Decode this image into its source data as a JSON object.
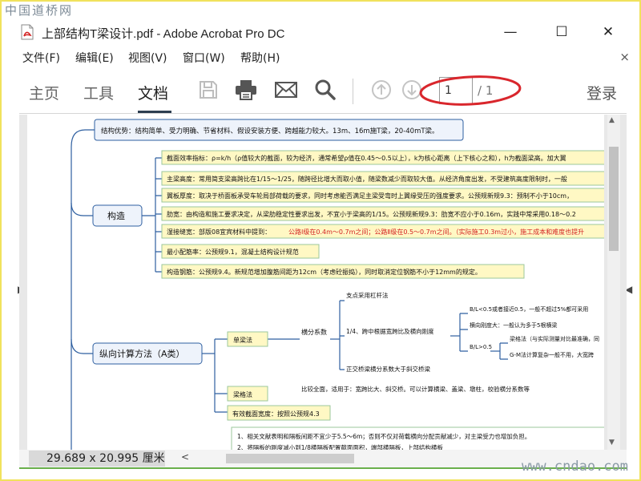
{
  "watermark": {
    "top": "中国道桥网",
    "bottom": "www.cndao.com"
  },
  "window": {
    "title": "上部结构T梁设计.pdf - Adobe Acrobat Pro DC",
    "minimize": "—",
    "maximize": "☐",
    "close": "✕"
  },
  "menu": {
    "items": [
      "文件(F)",
      "编辑(E)",
      "视图(V)",
      "窗口(W)",
      "帮助(H)"
    ],
    "close": "×"
  },
  "toolbar": {
    "tabs": [
      "主页",
      "工具",
      "文档"
    ],
    "active_tab": "文档",
    "page_current": "1",
    "page_total": "/ 1",
    "login": "登录"
  },
  "status": {
    "page_size": "29.689 x 20.995 厘米"
  },
  "colors": {
    "accent": "#2d3e50",
    "highlight_ellipse": "#d9262c",
    "node_border": "#9bc79b",
    "node_fill_yellow": "#fff8c4",
    "node_fill_blue": "#eef3fb",
    "line": "#2e5fa0"
  },
  "mindmap": {
    "top": "结构优势：结构简单、受力明确、节省材料、假设安装方便、跨越能力较大。13m、16m施T梁，20-40mT梁。",
    "construct": "构造",
    "construct_items": [
      "截面效率指标：ρ=k/h（ρ值较大的截面，较为经济，通常希望ρ值在0.45～0.5以上），k为核心距离（上下核心之和），h为截面梁高。加大翼",
      "主梁高度：常用简支梁高跨比在1/15～1/25，随跨径比增大而取小值，随梁数减少而取较大值。从经济角度出发，不受建筑高度限制时，一般",
      "翼板厚度：取决于桥面板承受车轮局部荷载的要求，同时考虑能否满足主梁受弯时上翼缘受压的强度要求。公预规新规9.3：预制不小于10cm，",
      "肋宽：由构造和施工要求决定，从梁肋稳定性要求出发，不宜小于梁高的1/15。公预规新规9.3：肋宽不应小于0.16m，实践中常采用0.18～0.2",
      "湿接缝宽：部版08宜宾材料中提到：",
      "最小配筋率：公预规9.1，混凝土结构设计规范",
      "构造钢筋：公预规9.4。新规范增加腹筋间距为12cm（考虑砼振捣），同时取消定位钢筋不小于12mm的规定。"
    ],
    "wet_joint_red": "公路Ⅰ级在0.4m～0.7m之间；公路Ⅱ级在0.5～0.7m之间。（实际施工0.3m过小，施工成本和难度也提升",
    "longitudinal": "纵向计算方法（A类）",
    "single_beam": "单梁法",
    "lateral_coef": "横分系数",
    "branch_lever": "支点采用杠杆法",
    "branch_quarter": "1/4、跨中根据宽跨比及横向刚度",
    "branch_eccentric": "正交桥梁横分系数大于斜交桥梁",
    "bl_small": "B/L<0.5或者接近0.5，一般不超过5%都可采用",
    "lateral_stiff": "横向刚度大：一般认为多于5根横梁",
    "bl_big": "B/L>0.5",
    "grid_beam": "梁格法（与实际测量对比最准确，同",
    "gm_method": "G-M法计算复杂一般不用，大宽跨",
    "grid_method": "梁格法",
    "grid_desc": "比较全面，适用于：宽跨比大、斜交桥。可以计算横梁、盖梁、墩柱，校验横分系数等",
    "effective_width": "有效截面宽度：按照公预规4.3",
    "note1": "1、相关文献表明和隔板间距不宜少于5.5～6m；否则不仅对荷载横向分配贡献减少，对主梁受力也增加负担。",
    "note2": "2、将隔板的刚度减小到1/8横隔板配置截面面积，端部横隔板，上部结构横板"
  }
}
